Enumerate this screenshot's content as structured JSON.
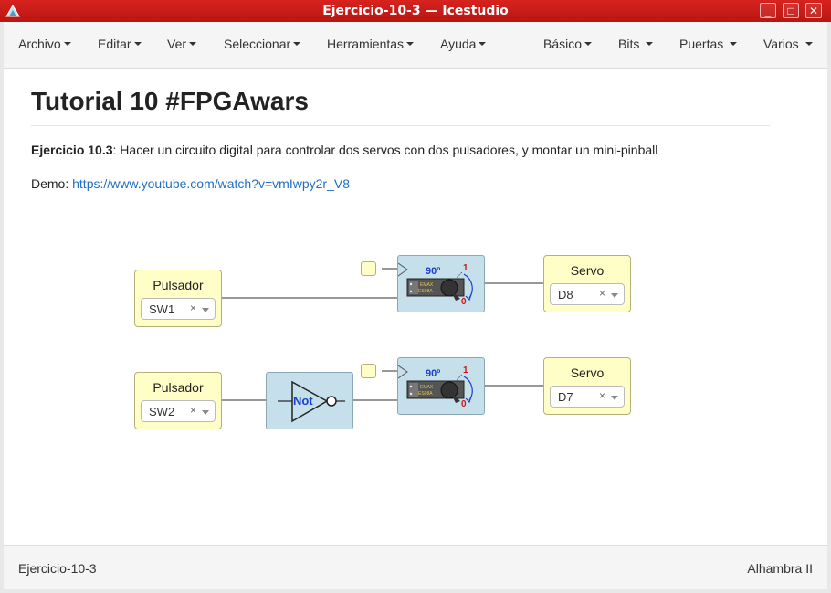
{
  "window": {
    "title": "Ejercicio-10-3 — Icestudio",
    "controls": [
      "minimize-icon",
      "maximize-icon",
      "close-icon"
    ]
  },
  "menubar": {
    "left": [
      "Archivo",
      "Editar",
      "Ver",
      "Seleccionar",
      "Herramientas",
      "Ayuda"
    ],
    "right": [
      "Básico",
      "Bits",
      "Puertas",
      "Varios"
    ]
  },
  "doc": {
    "heading": "Tutorial 10 #FPGAwars",
    "exercise_bold": "Ejercicio 10.3",
    "exercise_text": ": Hacer un circuito digital para controlar dos servos con dos pulsadores, y montar un mini-pinball",
    "demo_label": "Demo: ",
    "demo_link": "https://www.youtube.com/watch?v=vmIwpy2r_V8"
  },
  "circuit": {
    "inputs": [
      {
        "label": "Pulsador",
        "value": "SW1"
      },
      {
        "label": "Pulsador",
        "value": "SW2"
      }
    ],
    "outputs": [
      {
        "label": "Servo",
        "value": "D8"
      },
      {
        "label": "Servo",
        "value": "D7"
      }
    ],
    "not_gate": {
      "label": "Not"
    },
    "servo_block": {
      "angle": "90º",
      "state_on": "1",
      "state_off": "0",
      "brand": "EMAX",
      "model": "ES08A"
    },
    "clear_symbol": "×"
  },
  "statusbar": {
    "project": "Ejercicio-10-3",
    "board": "Alhambra II"
  },
  "colors": {
    "titlebar": "#c91b17",
    "block_yellow": "#fffec6",
    "block_blue": "#c5e0ea",
    "link": "#1f6fc5"
  }
}
